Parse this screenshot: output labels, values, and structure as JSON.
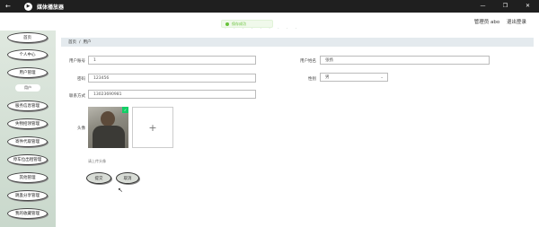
{
  "window": {
    "title": "媒体播放器",
    "controls": [
      "—",
      "❐",
      "✕"
    ]
  },
  "topbar": {
    "faded_title": "· · · · · · · · ·",
    "admin_label": "管理员 abo",
    "logout_label": "退出登录"
  },
  "toast": {
    "message": "保存成功"
  },
  "sidebar": {
    "items": [
      {
        "label": "首页"
      },
      {
        "label": "个人中心"
      },
      {
        "label": "用户管理"
      },
      {
        "label": "用户"
      },
      {
        "label": "服务信息管理"
      },
      {
        "label": "失物招领管理"
      },
      {
        "label": "寄件代取管理"
      },
      {
        "label": "停车位出租管理"
      },
      {
        "label": "其他管理"
      },
      {
        "label": "跳蚤分享管理"
      },
      {
        "label": "我的收藏管理"
      }
    ]
  },
  "breadcrumb": {
    "home": "首页",
    "separator": "/",
    "current": "用户"
  },
  "form": {
    "account_label": "用户账号",
    "account_value": "1",
    "name_label": "用户姓名",
    "name_value": "张扬",
    "password_label": "密码",
    "password_value": "123456",
    "gender_label": "性别",
    "gender_value": "男",
    "phone_label": "联系方式",
    "phone_value": "13023690981",
    "avatar_label": "头像",
    "upload_plus": "+",
    "upload_tip": "请上传头像",
    "submit_label": "提交",
    "cancel_label": "取消"
  }
}
